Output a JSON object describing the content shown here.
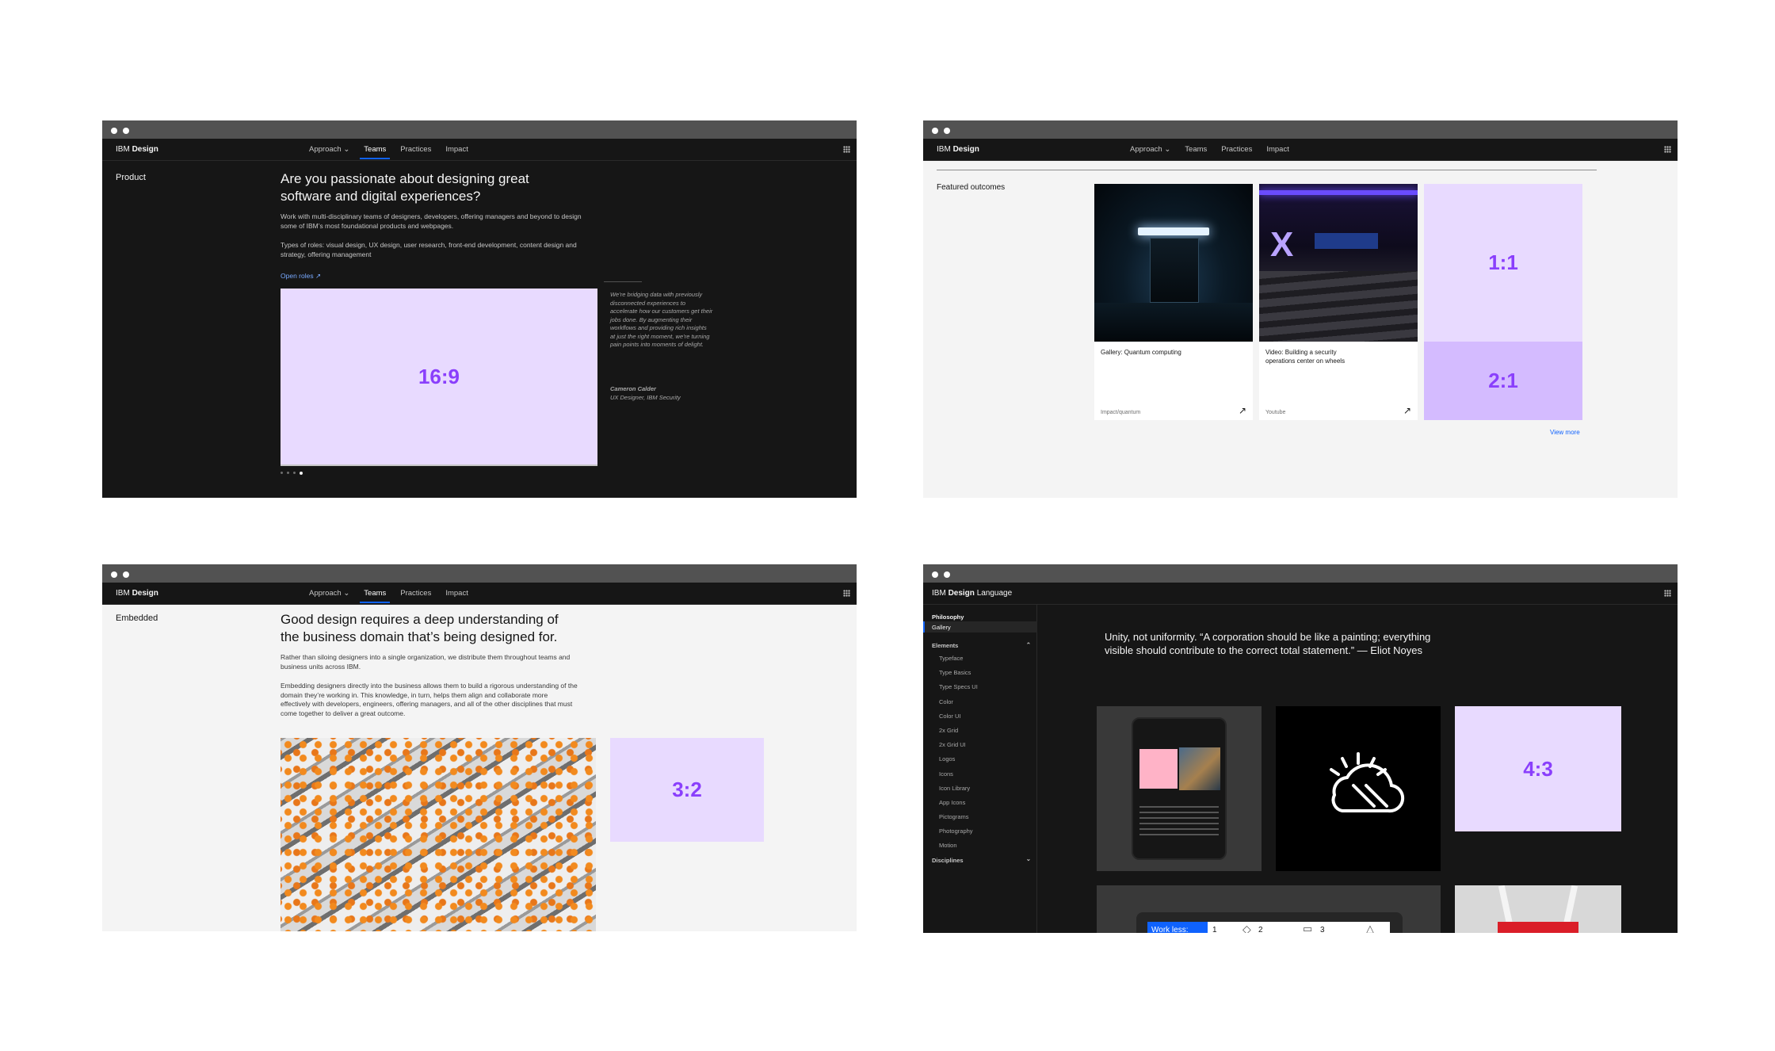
{
  "colors": {
    "accent": "#0f62fe",
    "placeholder_bg": "#e8daff",
    "placeholder_text": "#8a3ffc",
    "placeholder_bg_2": "#d4bbff"
  },
  "nav": {
    "brand_prefix": "IBM",
    "brand_name": "Design",
    "items": [
      {
        "label": "Approach",
        "has_dropdown": true
      },
      {
        "label": "Teams"
      },
      {
        "label": "Practices"
      },
      {
        "label": "Impact"
      }
    ],
    "active": "Teams"
  },
  "win1": {
    "page_label": "Product",
    "heading": "Are you passionate about designing great software and digital experiences?",
    "para1": "Work with multi-disciplinary teams of designers, developers, offering managers and beyond to design some of IBM’s most foundational products and webpages.",
    "para2": "Types of roles: visual design, UX design, user research, front-end development, content design and strategy, offering management",
    "link": "Open roles ↗",
    "placeholder": "16:9",
    "quote": "We’re bridging data with previously disconnected experiences to accelerate how our customers get their jobs done. By augmenting their workflows and providing rich insights at just the right moment, we’re turning pain points into moments of delight.",
    "author_name": "Cameron Calder",
    "author_title": "UX Designer, IBM Security"
  },
  "win2": {
    "section_label": "Featured outcomes",
    "cards": [
      {
        "title": "Gallery: Quantum computing",
        "meta": "Impact/quantum"
      },
      {
        "title": "Video: Building a security operations center on wheels",
        "meta": "Youtube"
      }
    ],
    "placeholder_top": "1:1",
    "placeholder_bottom": "2:1",
    "view_more": "View more"
  },
  "win3": {
    "page_label": "Embedded",
    "heading": "Good design requires a deep understanding of the business domain that’s being designed for.",
    "para1": "Rather than siloing designers into a single organization, we distribute them throughout teams and business units across IBM.",
    "para2": "Embedding designers directly into the business allows them to build a rigorous understanding of the domain they’re working in. This knowledge, in turn, helps them align and collaborate more effectively with developers, engineers, offering managers, and all of the other disciplines that must come together to deliver a great outcome.",
    "placeholder": "3:2"
  },
  "win4": {
    "brand_prefix": "IBM",
    "brand_name": "Design",
    "brand_suffix": "Language",
    "sidebar": {
      "philosophy": "Philosophy",
      "gallery": "Gallery",
      "elements": "Elements",
      "items": [
        "Typeface",
        "Type Basics",
        "Type Specs UI",
        "Color",
        "Color UI",
        "2x Grid",
        "2x Grid UI",
        "Logos",
        "Icons",
        "Icon Library",
        "App Icons",
        "Pictograms",
        "Photography",
        "Motion"
      ],
      "disciplines": "Disciplines"
    },
    "quote": "Unity, not uniformity. “A corporation should be like a painting; everything visible should contribute to the correct total statement.” — Eliot Noyes",
    "placeholder": "4:3",
    "tablet_bar": {
      "label": "Work less:",
      "steps": [
        "1",
        "2",
        "3"
      ]
    }
  }
}
